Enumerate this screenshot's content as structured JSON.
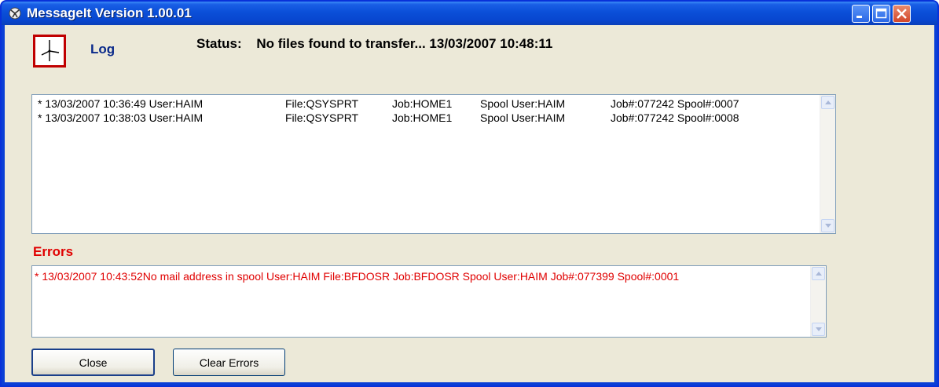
{
  "window": {
    "title": "MessageIt Version 1.00.01",
    "icons": {
      "app": "app-icon",
      "minimize": "minimize-icon",
      "maximize": "maximize-icon",
      "close": "close-icon"
    }
  },
  "header": {
    "clock_icon": "clock-icon",
    "log_label": "Log",
    "status_label": "Status:",
    "status_value": "No files found to transfer... 13/03/2007 10:48:11"
  },
  "log": {
    "rows": [
      {
        "time": "* 13/03/2007 10:36:49 User:HAIM",
        "file": "File:QSYSPRT",
        "job": "Job:HOME1",
        "spool_user": "Spool User:HAIM",
        "job_spool": "Job#:077242 Spool#:0007"
      },
      {
        "time": "* 13/03/2007 10:38:03 User:HAIM",
        "file": "File:QSYSPRT",
        "job": "Job:HOME1",
        "spool_user": "Spool User:HAIM",
        "job_spool": "Job#:077242 Spool#:0008"
      }
    ]
  },
  "errors": {
    "label": "Errors",
    "text": "* 13/03/2007 10:43:52No mail address in spool User:HAIM File:BFDOSR Job:BFDOSR Spool User:HAIM Job#:077399 Spool#:0001"
  },
  "buttons": {
    "close_label": "Close",
    "clear_errors_label": "Clear Errors"
  },
  "colors": {
    "titlebar": "#0a4fd8",
    "error_text": "#e00000",
    "log_label": "#0a2a8a",
    "window_bg": "#ece9d8"
  }
}
